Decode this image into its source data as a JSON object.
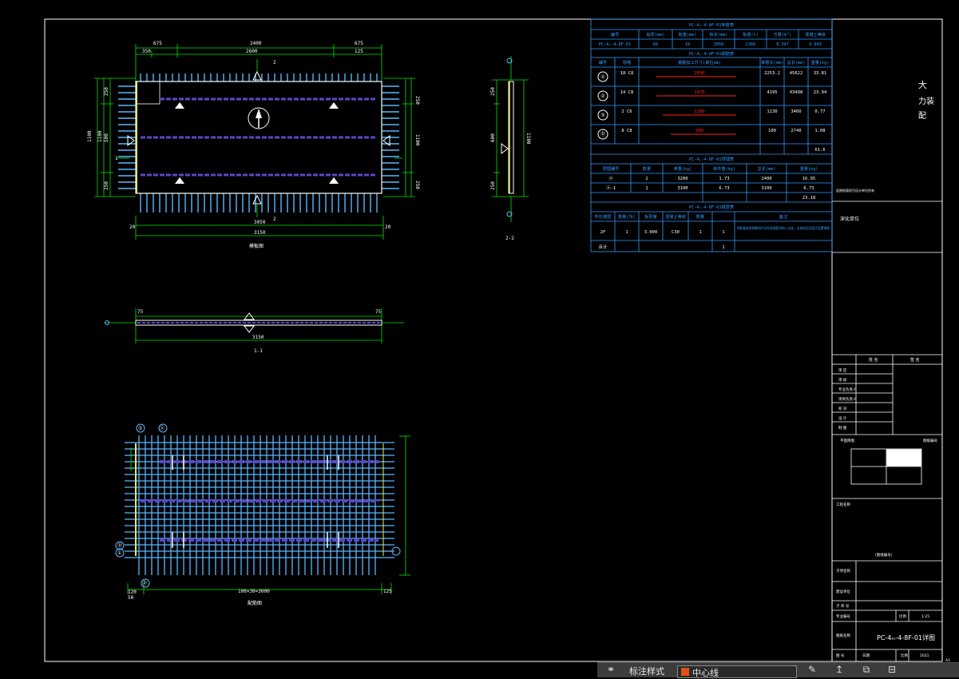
{
  "drawing": {
    "views": {
      "plan_label": "模板图",
      "section11": "1-1",
      "section22": "2-2",
      "rebar_label": "配筋图",
      "mark_2": "2",
      "mark_1": "1"
    },
    "plan_dims": {
      "top_left": "675",
      "top_mid": "2400",
      "top_right": "675",
      "top_sub1": "350",
      "top_sub2": "2600",
      "top_sub3": "125",
      "left_a": "1100",
      "left_b": "1100",
      "left_c": "250",
      "left_d": "500",
      "left_e": "250",
      "right_a": "250",
      "right_b": "1100",
      "right_c": "250",
      "bot_1": "3050",
      "bot_2": "3150",
      "bot_edge_l": "20",
      "bot_edge_r": "20"
    },
    "sec11_dims": {
      "total": "3150",
      "l": "75",
      "r": "75"
    },
    "sec22_dims": {
      "a": "250",
      "b": "600",
      "c": "250",
      "d": "1100"
    },
    "rebar_dims": {
      "left": "120",
      "mid": "100×30=3000",
      "right": "125",
      "left2": "50",
      "b1": "100",
      "b2": "(5)",
      "b3": "01",
      "b4": "Ⓓ"
    },
    "rebar_marks": {
      "m1": "①",
      "m2": "②",
      "m3": "Ⓓ",
      "m4": "ⓐ"
    }
  },
  "table1": {
    "title": "PC-4ₘ-4-8F-01参数表",
    "headers": [
      "编号",
      "板厚(mm)",
      "板宽(mm)",
      "板长(mm)",
      "板重(t)",
      "方量(m³)",
      "混凝土等级"
    ],
    "row": [
      "PC-4ₘ-4-8F-01",
      "60",
      "10",
      "3050",
      "1360",
      "0.397",
      "0.993"
    ]
  },
  "table2": {
    "title": "PC-4ₘ-4-8F-01钢筋表",
    "headers": [
      "编号",
      "规格",
      "钢筋加工尺寸(单位mm)",
      "单根长(mm)",
      "总长(mm)",
      "重量(kg)"
    ],
    "rows": [
      [
        "①",
        "18 C8",
        "2890",
        "2253.2",
        "45622",
        "33.81"
      ],
      [
        "②",
        "14 C8",
        "1470",
        "4195",
        "43498",
        "23.94"
      ],
      [
        "③",
        "2 C6",
        "1200",
        "1130",
        "3460",
        "0.77"
      ],
      [
        "Ⓓ",
        "8 C8",
        "300",
        "100",
        "2740",
        "1.08"
      ]
    ],
    "total": "61.6"
  },
  "table3": {
    "title": "PC-4ₘ-4-8F-01预埋表",
    "headers": [
      "预埋编号",
      "数量",
      "单重(kg)",
      "单件重(kg)",
      "总长(mm)",
      "重量(kg)"
    ],
    "rows": [
      [
        "ⓐ",
        "2",
        "3200",
        "1.73",
        "2400",
        "16.95"
      ],
      [
        "ⓐ-1",
        "1",
        "3100",
        "6.73",
        "3100",
        "6.73"
      ]
    ],
    "total": "23.18"
  },
  "table4": {
    "title": "PC-4ₘ-4-8F-01楼层表",
    "headers": [
      "所在楼层",
      "数量(块)",
      "板厚度",
      "混凝土等级",
      "数量",
      "备注"
    ],
    "rows": [
      [
        "2F",
        "1",
        "3.000",
        "C30",
        "1",
        "1"
      ]
    ],
    "note": "预制板底部钢筋网片及桁架钢筋均伸入支座，支座处现浇层内设置钢筋",
    "total_label": "合计",
    "total_value": "1"
  },
  "titleblock": {
    "stamp_big": "大",
    "stamp_2": "力装",
    "stamp_3": "配",
    "company_note": "此图纸版权归设计单位所有",
    "design_unit": "深化单位",
    "col_a": "姓 名",
    "col_b": "签 名",
    "roles": [
      "审 定",
      "审 核",
      "专业负责人",
      "项目负责人",
      "校 对",
      "设 计",
      "制 图"
    ],
    "key_label": "平面简图",
    "key_label_r": "图纸编号",
    "project_label": "工程名称",
    "subject_label": "子项名称",
    "client_label": "建设单位",
    "subproject": "子 项 号",
    "scale_label": "比例",
    "scale_value": "1:25",
    "sheet_label": "专业编号",
    "drawing_name_label": "图纸名称",
    "drawing_name": "PC-4ₘ-4-8F-01详图",
    "no_label": "图 号",
    "date_label": "日期",
    "date_value": "2021",
    "version": "A2",
    "mid_note": "(图纸编号)"
  },
  "statusbar": {
    "filter_label": "标注样式",
    "layer_label": "中心线"
  },
  "colors": {
    "frame": "#ffffff",
    "rebar": "#2f7fff",
    "rebar_light": "#59b7ff",
    "dim": "#00e600",
    "table": "#2f9bff",
    "accent_red": "#ff2020",
    "slab_edge": "#e8e860",
    "bar_purple": "#5a48c8"
  }
}
